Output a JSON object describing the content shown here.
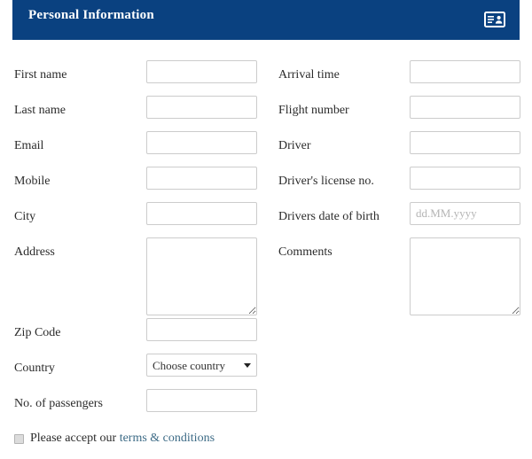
{
  "header": {
    "title": "Personal Information",
    "icon": "id-card-icon",
    "background_color": "#0a4180",
    "text_color": "#ffffff"
  },
  "columns": {
    "left": [
      {
        "label": "First name",
        "type": "text",
        "value": "",
        "placeholder": ""
      },
      {
        "label": "Last name",
        "type": "text",
        "value": "",
        "placeholder": ""
      },
      {
        "label": "Email",
        "type": "text",
        "value": "",
        "placeholder": ""
      },
      {
        "label": "Mobile",
        "type": "text",
        "value": "",
        "placeholder": ""
      },
      {
        "label": "City",
        "type": "text",
        "value": "",
        "placeholder": ""
      },
      {
        "label": "Address",
        "type": "textarea",
        "value": "",
        "placeholder": ""
      },
      {
        "label": "Zip Code",
        "type": "text",
        "value": "",
        "placeholder": ""
      },
      {
        "label": "Country",
        "type": "select",
        "value": "Choose country",
        "placeholder": ""
      },
      {
        "label": "No. of passengers",
        "type": "text",
        "value": "",
        "placeholder": ""
      }
    ],
    "right": [
      {
        "label": "Arrival time",
        "type": "text",
        "value": "",
        "placeholder": ""
      },
      {
        "label": "Flight number",
        "type": "text",
        "value": "",
        "placeholder": ""
      },
      {
        "label": "Driver",
        "type": "text",
        "value": "",
        "placeholder": ""
      },
      {
        "label": "Driver's license no.",
        "type": "text",
        "value": "",
        "placeholder": ""
      },
      {
        "label": "Drivers date of birth",
        "type": "text",
        "value": "",
        "placeholder": "dd.MM.yyyy"
      },
      {
        "label": "Comments",
        "type": "textarea",
        "value": "",
        "placeholder": ""
      }
    ]
  },
  "country_select": {
    "selected": "Choose country",
    "options": [
      "Choose country"
    ]
  },
  "terms": {
    "checked": false,
    "text_before": "Please accept our ",
    "link_label": "terms & conditions",
    "link_color": "#3d6b86"
  }
}
